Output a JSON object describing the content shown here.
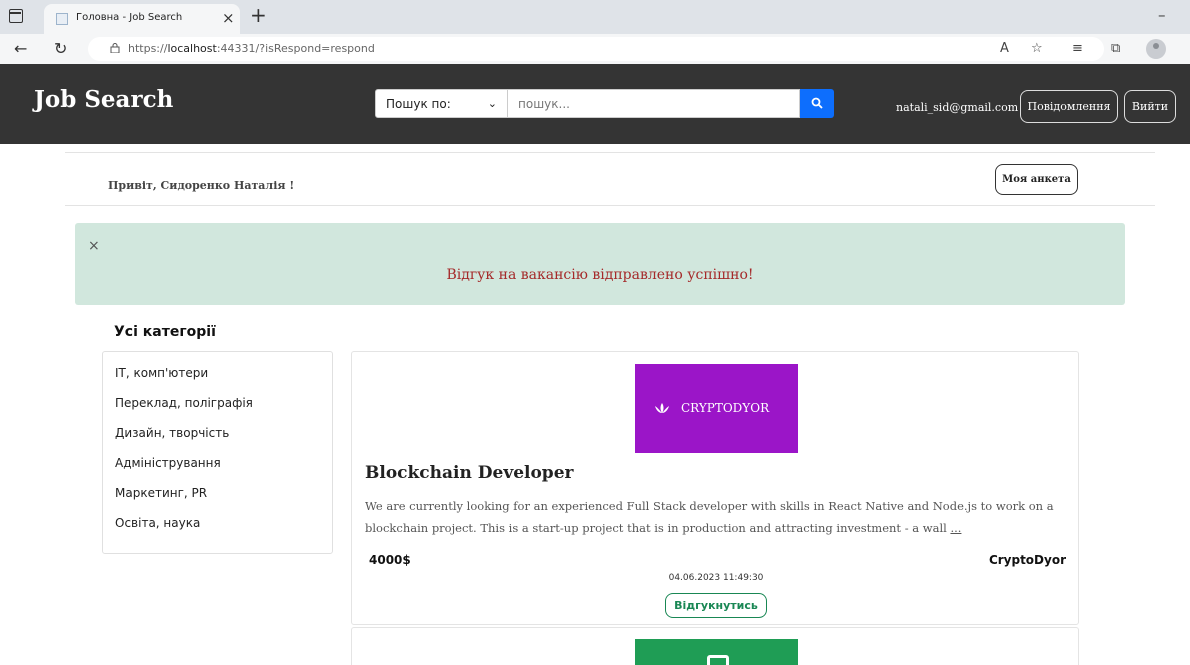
{
  "browser": {
    "tab_title": "Головна - Job Search",
    "url_prefix": "https://",
    "url_host": "localhost",
    "url_rest": ":44331/?isRespond=respond"
  },
  "header": {
    "brand": "Job Search",
    "search_by_label": "Пошук по:",
    "search_placeholder": "пошук...",
    "user_email": "natali_sid@gmail.com",
    "messages_label": "Повідомлення",
    "logout_label": "Вийти"
  },
  "greeting": {
    "text": "Привіт, Сидоренко Наталія !",
    "profile_button": "Моя анкета"
  },
  "alert": {
    "close": "×",
    "message": "Відгук на вакансію відправлено успішно!"
  },
  "categories": {
    "title": "Усі категорії",
    "items": [
      {
        "label": "IT, комп'ютери"
      },
      {
        "label": "Переклад, поліграфія"
      },
      {
        "label": "Дизайн, творчість"
      },
      {
        "label": "Адміністрування"
      },
      {
        "label": "Маркетинг, PR"
      },
      {
        "label": "Освіта, наука"
      }
    ]
  },
  "vacancies": [
    {
      "logo_text": "CRYPTODYOR",
      "logo_color": "#9b15c8",
      "title": "Blockchain Developer",
      "description": "We are currently looking for an experienced Full Stack developer with skills in React Native and Node.js to work on a blockchain project. This is a start-up project that is in production and attracting investment - a wall",
      "more": "...",
      "salary": "4000$",
      "company": "CryptoDyor",
      "date": "04.06.2023 11:49:30",
      "respond_label": "Відгукнутись"
    },
    {
      "logo_color": "#1f9d55"
    }
  ],
  "colors": {
    "header_bg": "#343434",
    "alert_bg": "#d1e7dd",
    "alert_text": "#a52a2a",
    "primary": "#0d6efd",
    "success": "#198754"
  }
}
